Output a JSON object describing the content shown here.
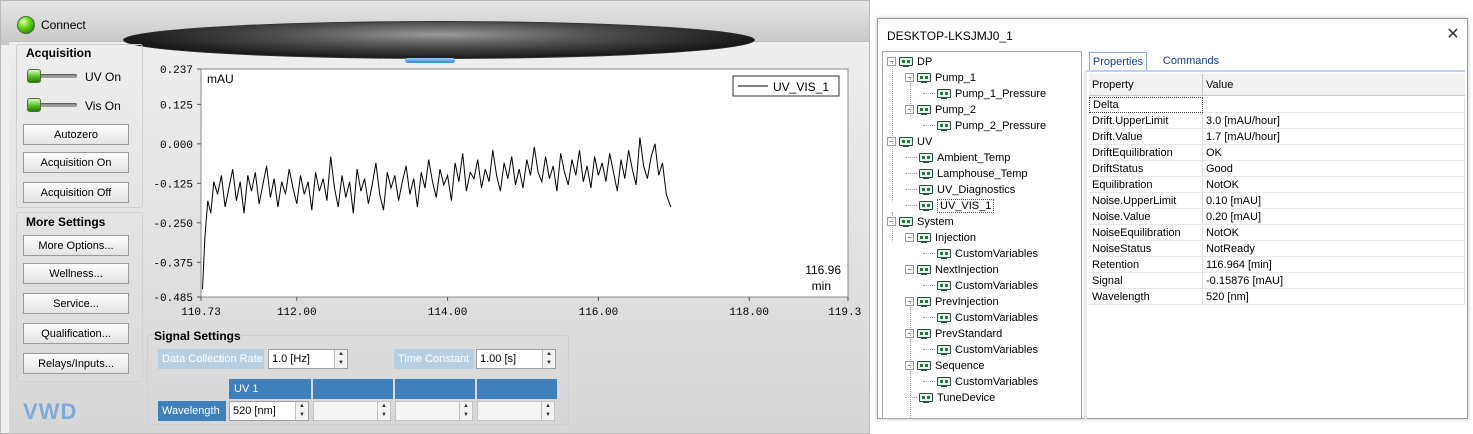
{
  "vwd": {
    "connect_label": "Connect",
    "logo": "VWD",
    "acquisition": {
      "title": "Acquisition",
      "uv_toggle_label": "UV On",
      "vis_toggle_label": "Vis On",
      "buttons": [
        "Autozero",
        "Acquisition On",
        "Acquisition Off"
      ]
    },
    "more_settings": {
      "title": "More Settings",
      "buttons": [
        "More Options...",
        "Wellness...",
        "Service...",
        "Qualification...",
        "Relays/Inputs..."
      ]
    },
    "signal_settings": {
      "title": "Signal Settings",
      "data_collection_rate_label": "Data Collection Rate",
      "data_collection_rate_value": "1.0 [Hz]",
      "time_constant_label": "Time Constant",
      "time_constant_value": "1.00 [s]",
      "channel_columns": [
        "UV 1",
        "",
        "",
        ""
      ],
      "wavelength_label": "Wavelength",
      "wavelength_value": "520 [nm]"
    }
  },
  "chart_data": {
    "type": "line",
    "ylabel": "mAU",
    "xlim": [
      110.73,
      119.31
    ],
    "ylim": [
      -0.485,
      0.237
    ],
    "x_ticks": [
      "110.73",
      "112.00",
      "114.00",
      "116.00",
      "118.00",
      "119.31"
    ],
    "y_ticks": [
      "0.237",
      "0.125",
      "0.000",
      "-0.125",
      "-0.250",
      "-0.375",
      "-0.485"
    ],
    "current_time_value": "116.96",
    "current_time_unit": "min",
    "grid": false,
    "legend_position": "top-right",
    "series": [
      {
        "name": "UV_VIS_1",
        "color": "#000000",
        "x": [
          110.75,
          110.78,
          110.82,
          110.86,
          110.9,
          110.95,
          111.0,
          111.05,
          111.1,
          111.15,
          111.2,
          111.25,
          111.3,
          111.35,
          111.4,
          111.45,
          111.5,
          111.55,
          111.6,
          111.65,
          111.7,
          111.75,
          111.8,
          111.85,
          111.9,
          111.95,
          112.0,
          112.05,
          112.1,
          112.15,
          112.2,
          112.25,
          112.3,
          112.35,
          112.4,
          112.45,
          112.5,
          112.55,
          112.6,
          112.65,
          112.7,
          112.75,
          112.8,
          112.85,
          112.9,
          112.95,
          113.0,
          113.05,
          113.1,
          113.15,
          113.2,
          113.25,
          113.3,
          113.35,
          113.4,
          113.45,
          113.5,
          113.55,
          113.6,
          113.65,
          113.7,
          113.75,
          113.8,
          113.85,
          113.9,
          113.95,
          114.0,
          114.05,
          114.1,
          114.15,
          114.2,
          114.25,
          114.3,
          114.35,
          114.4,
          114.45,
          114.5,
          114.55,
          114.6,
          114.65,
          114.7,
          114.75,
          114.8,
          114.85,
          114.9,
          114.95,
          115.0,
          115.05,
          115.1,
          115.15,
          115.2,
          115.25,
          115.3,
          115.35,
          115.4,
          115.45,
          115.5,
          115.55,
          115.6,
          115.65,
          115.7,
          115.75,
          115.8,
          115.85,
          115.9,
          115.95,
          116.0,
          116.05,
          116.1,
          116.15,
          116.2,
          116.25,
          116.3,
          116.35,
          116.4,
          116.45,
          116.5,
          116.55,
          116.6,
          116.65,
          116.7,
          116.75,
          116.8,
          116.85,
          116.9,
          116.96
        ],
        "y": [
          -0.46,
          -0.3,
          -0.18,
          -0.22,
          -0.12,
          -0.16,
          -0.1,
          -0.2,
          -0.14,
          -0.08,
          -0.18,
          -0.12,
          -0.22,
          -0.1,
          -0.15,
          -0.09,
          -0.19,
          -0.13,
          -0.07,
          -0.17,
          -0.11,
          -0.2,
          -0.12,
          -0.16,
          -0.08,
          -0.14,
          -0.19,
          -0.1,
          -0.16,
          -0.12,
          -0.21,
          -0.09,
          -0.15,
          -0.11,
          -0.18,
          -0.04,
          -0.14,
          -0.2,
          -0.1,
          -0.17,
          -0.12,
          -0.22,
          -0.08,
          -0.15,
          -0.11,
          -0.19,
          -0.13,
          -0.06,
          -0.16,
          -0.21,
          -0.09,
          -0.14,
          -0.1,
          -0.18,
          -0.12,
          -0.07,
          -0.16,
          -0.11,
          -0.2,
          -0.09,
          -0.14,
          -0.05,
          -0.12,
          -0.17,
          -0.08,
          -0.13,
          -0.1,
          -0.18,
          -0.06,
          -0.12,
          -0.03,
          -0.15,
          -0.09,
          -0.11,
          -0.05,
          -0.14,
          -0.08,
          -0.12,
          -0.02,
          -0.1,
          -0.15,
          -0.06,
          -0.11,
          -0.04,
          -0.13,
          -0.08,
          -0.14,
          -0.05,
          -0.1,
          -0.01,
          -0.09,
          -0.12,
          -0.04,
          -0.11,
          -0.07,
          -0.15,
          -0.03,
          -0.09,
          -0.13,
          -0.05,
          -0.1,
          -0.02,
          -0.12,
          -0.07,
          -0.14,
          -0.04,
          -0.1,
          -0.06,
          -0.12,
          -0.03,
          -0.09,
          -0.15,
          -0.05,
          -0.11,
          -0.02,
          -0.08,
          -0.13,
          0.02,
          -0.07,
          -0.11,
          -0.04,
          0.0,
          -0.1,
          -0.06,
          -0.16,
          -0.2
        ]
      }
    ]
  },
  "device_window": {
    "title": "DESKTOP-LKSJMJ0_1",
    "close_glyph": "✕",
    "tree": [
      {
        "label": "DP",
        "level": 0,
        "expander": "−"
      },
      {
        "label": "Pump_1",
        "level": 1,
        "expander": "−"
      },
      {
        "label": "Pump_1_Pressure",
        "level": 2
      },
      {
        "label": "Pump_2",
        "level": 1,
        "expander": "−"
      },
      {
        "label": "Pump_2_Pressure",
        "level": 2
      },
      {
        "label": "UV",
        "level": 0,
        "expander": "−"
      },
      {
        "label": "Ambient_Temp",
        "level": 1
      },
      {
        "label": "Lamphouse_Temp",
        "level": 1
      },
      {
        "label": "UV_Diagnostics",
        "level": 1
      },
      {
        "label": "UV_VIS_1",
        "level": 1,
        "selected": true
      },
      {
        "label": "System",
        "level": 0,
        "expander": "−"
      },
      {
        "label": "Injection",
        "level": 1,
        "expander": "−"
      },
      {
        "label": "CustomVariables",
        "level": 2
      },
      {
        "label": "NextInjection",
        "level": 1,
        "expander": "−"
      },
      {
        "label": "CustomVariables",
        "level": 2
      },
      {
        "label": "PrevInjection",
        "level": 1,
        "expander": "−"
      },
      {
        "label": "CustomVariables",
        "level": 2
      },
      {
        "label": "PrevStandard",
        "level": 1,
        "expander": "−"
      },
      {
        "label": "CustomVariables",
        "level": 2
      },
      {
        "label": "Sequence",
        "level": 1,
        "expander": "−"
      },
      {
        "label": "CustomVariables",
        "level": 2
      },
      {
        "label": "TuneDevice",
        "level": 1
      }
    ],
    "tabs": {
      "properties": "Properties",
      "commands": "Commands"
    },
    "grid_headers": {
      "property": "Property",
      "value": "Value"
    },
    "properties": [
      {
        "name": "Delta",
        "value": ""
      },
      {
        "name": "Drift.UpperLimit",
        "value": "3.0 [mAU/hour]"
      },
      {
        "name": "Drift.Value",
        "value": "1.7 [mAU/hour]"
      },
      {
        "name": "DriftEquilibration",
        "value": "OK"
      },
      {
        "name": "DriftStatus",
        "value": "Good"
      },
      {
        "name": "Equilibration",
        "value": "NotOK"
      },
      {
        "name": "Noise.UpperLimit",
        "value": "0.10 [mAU]"
      },
      {
        "name": "Noise.Value",
        "value": "0.20 [mAU]"
      },
      {
        "name": "NoiseEquilibration",
        "value": "NotOK"
      },
      {
        "name": "NoiseStatus",
        "value": "NotReady"
      },
      {
        "name": "Retention",
        "value": "116.964 [min]"
      },
      {
        "name": "Signal",
        "value": "-0.15876 [mAU]"
      },
      {
        "name": "Wavelength",
        "value": "520 [nm]"
      }
    ]
  }
}
